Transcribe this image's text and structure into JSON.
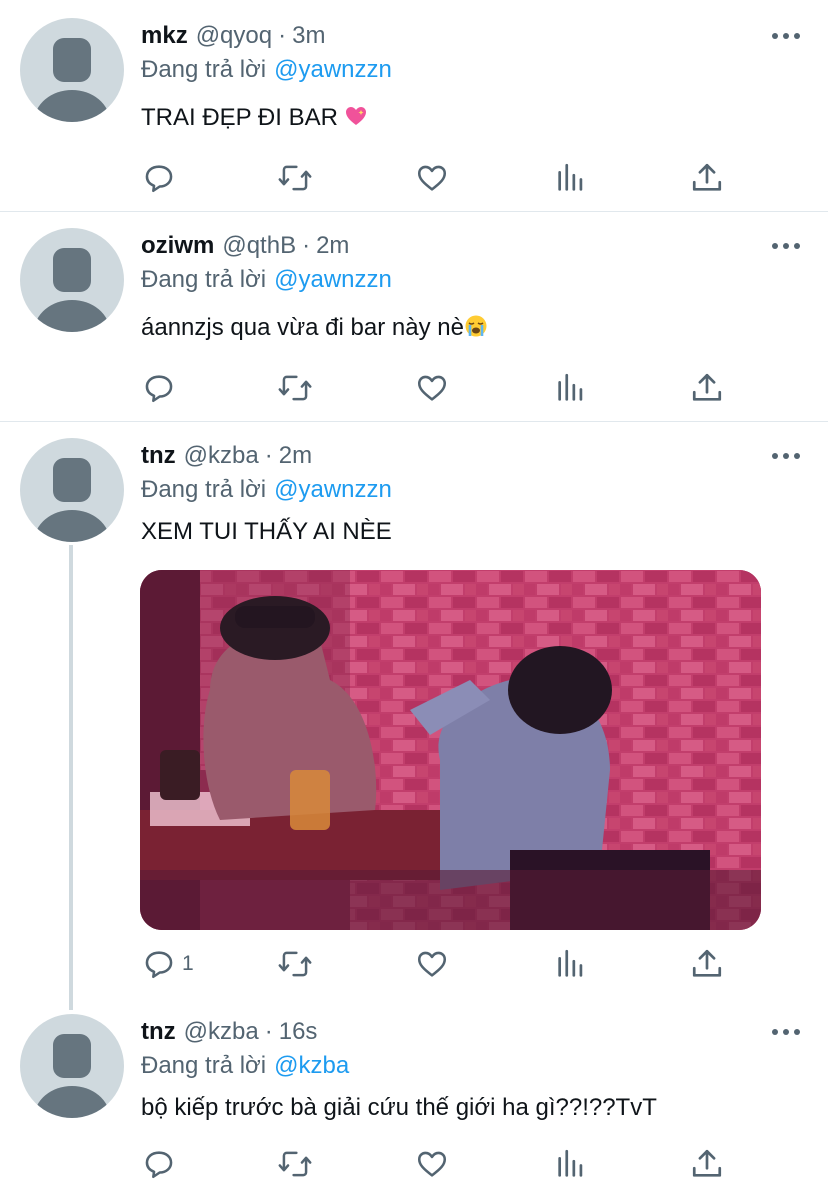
{
  "tweets": [
    {
      "name": "mkz",
      "handle": "@qyoq",
      "separator": "·",
      "time": "3m",
      "replying_prefix": "Đang trả lời",
      "replying_to": "@yawnzzn",
      "text": "TRAI ĐẸP ĐI BAR",
      "emoji": "sparkling-heart-emoji",
      "reply_count": ""
    },
    {
      "name": "oziwm",
      "handle": "@qthB",
      "separator": "·",
      "time": "2m",
      "replying_prefix": "Đang trả lời",
      "replying_to": "@yawnzzn",
      "text": "áannzjs qua vừa đi bar này nè",
      "emoji": "loudly-crying-face-emoji",
      "reply_count": ""
    },
    {
      "name": "tnz",
      "handle": "@kzba",
      "separator": "·",
      "time": "2m",
      "replying_prefix": "Đang trả lời",
      "replying_to": "@yawnzzn",
      "text": "XEM TUI THẤY AI NÈE",
      "has_photo": true,
      "reply_count": "1"
    },
    {
      "name": "tnz",
      "handle": "@kzba",
      "separator": "·",
      "time": "16s",
      "replying_prefix": "Đang trả lời",
      "replying_to": "@kzba",
      "text": "bộ kiếp trước bà giải cứu thế giới ha gì??!??TvT",
      "reply_count": ""
    }
  ],
  "icons": {
    "reply": "reply-icon",
    "retweet": "retweet-icon",
    "like": "like-icon",
    "views": "analytics-icon",
    "share": "share-icon",
    "more": "more-icon"
  },
  "colors": {
    "link": "#1d9bf0",
    "secondary_text": "#536471",
    "primary_text": "#0f1419",
    "divider": "#e1e8ed",
    "avatar_bg": "#cfd9de",
    "avatar_fg": "#66757f"
  }
}
